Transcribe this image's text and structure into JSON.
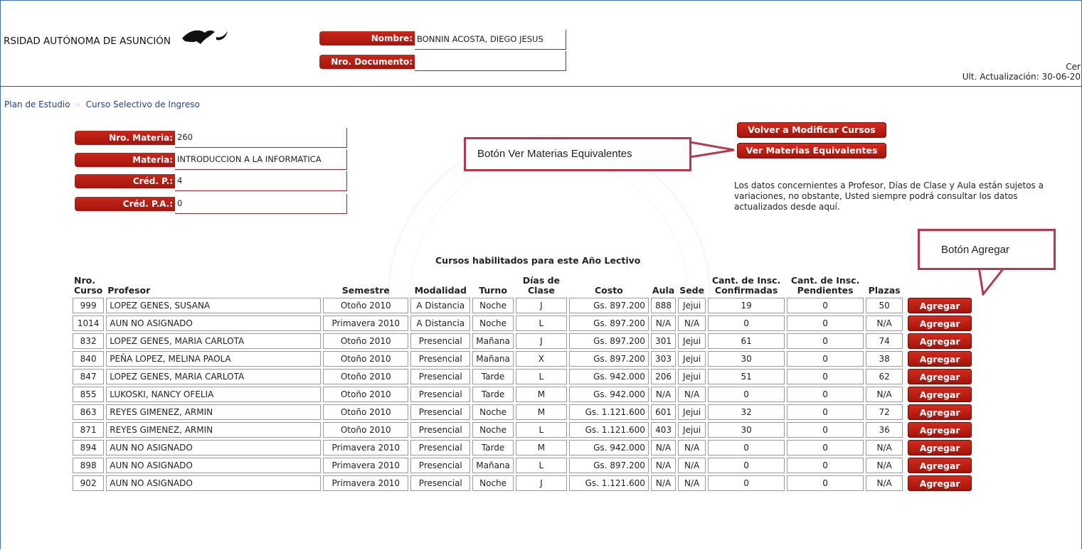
{
  "header": {
    "university": "RSIDAD AUTÓNOMA DE ASUNCIÓN",
    "nombre_label": "Nombre:",
    "nombre_value": "BONNIN ACOSTA, DIEGO JESUS",
    "documento_label": "Nro. Documento:",
    "documento_value": "",
    "top_right_1": "Cer",
    "top_right_2": "Ult. Actualización: 30-06-20"
  },
  "breadcrumb": {
    "item1": "Plan de Estudio",
    "separator": "⁘",
    "item2": "Curso Selectivo de Ingreso"
  },
  "materia": {
    "nro_label": "Nro. Materia:",
    "nro_value": "260",
    "materia_label": "Materia:",
    "materia_value": "INTRODUCCION A LA INFORMATICA",
    "credp_label": "Créd. P.:",
    "credp_value": "4",
    "credpa_label": "Créd. P.A.:",
    "credpa_value": "0"
  },
  "buttons": {
    "volver": "Volver a Modificar Cursos",
    "equivalentes": "Ver Materias Equivalentes"
  },
  "note": "Los datos concernientes a Profesor, Días de Clase y Aula están sujetos a variaciones, no obstante, Usted siempre podrá consultar los datos actualizados desde aquí.",
  "callouts": {
    "equivalentes": "Botón Ver Materias Equivalentes",
    "agregar": "Botón Agregar"
  },
  "table": {
    "caption": "Cursos habilitados para este Año Lectivo",
    "headers": {
      "nro_1": "Nro.",
      "nro_2": "Curso",
      "profesor": "Profesor",
      "semestre": "Semestre",
      "modalidad": "Modalidad",
      "turno": "Turno",
      "dias_1": "Días de",
      "dias_2": "Clase",
      "costo": "Costo",
      "aula": "Aula",
      "sede": "Sede",
      "conf_1": "Cant. de Insc.",
      "conf_2": "Confirmadas",
      "pend_1": "Cant. de Insc.",
      "pend_2": "Pendientes",
      "plazas": "Plazas"
    },
    "action_label": "Agregar",
    "rows": [
      {
        "nro": "999",
        "profesor": "LOPEZ GENES, SUSANA",
        "semestre": "Otoño 2010",
        "modalidad": "A Distancia",
        "turno": "Noche",
        "dias": "J",
        "costo": "Gs. 897.200",
        "aula": "888",
        "sede": "Jejui",
        "confirmadas": "19",
        "pendientes": "0",
        "plazas": "50"
      },
      {
        "nro": "1014",
        "profesor": "AUN NO ASIGNADO",
        "semestre": "Primavera 2010",
        "modalidad": "A Distancia",
        "turno": "Noche",
        "dias": "L",
        "costo": "Gs. 897.200",
        "aula": "N/A",
        "sede": "N/A",
        "confirmadas": "0",
        "pendientes": "0",
        "plazas": "N/A"
      },
      {
        "nro": "832",
        "profesor": "LOPEZ GENES, MARIA CARLOTA",
        "semestre": "Otoño 2010",
        "modalidad": "Presencial",
        "turno": "Mañana",
        "dias": "J",
        "costo": "Gs. 897.200",
        "aula": "301",
        "sede": "Jejui",
        "confirmadas": "61",
        "pendientes": "0",
        "plazas": "74"
      },
      {
        "nro": "840",
        "profesor": "PEÑA LOPEZ, MELINA PAOLA",
        "semestre": "Otoño 2010",
        "modalidad": "Presencial",
        "turno": "Mañana",
        "dias": "X",
        "costo": "Gs. 897.200",
        "aula": "303",
        "sede": "Jejui",
        "confirmadas": "30",
        "pendientes": "0",
        "plazas": "38"
      },
      {
        "nro": "847",
        "profesor": "LOPEZ GENES, MARIA CARLOTA",
        "semestre": "Otoño 2010",
        "modalidad": "Presencial",
        "turno": "Tarde",
        "dias": "L",
        "costo": "Gs. 942.000",
        "aula": "206",
        "sede": "Jejui",
        "confirmadas": "51",
        "pendientes": "0",
        "plazas": "62"
      },
      {
        "nro": "855",
        "profesor": "LUKOSKI, NANCY OFELIA",
        "semestre": "Otoño 2010",
        "modalidad": "Presencial",
        "turno": "Tarde",
        "dias": "M",
        "costo": "Gs. 942.000",
        "aula": "N/A",
        "sede": "N/A",
        "confirmadas": "0",
        "pendientes": "0",
        "plazas": "N/A"
      },
      {
        "nro": "863",
        "profesor": "REYES GIMENEZ, ARMIN",
        "semestre": "Otoño 2010",
        "modalidad": "Presencial",
        "turno": "Noche",
        "dias": "M",
        "costo": "Gs. 1.121.600",
        "aula": "601",
        "sede": "Jejui",
        "confirmadas": "32",
        "pendientes": "0",
        "plazas": "72"
      },
      {
        "nro": "871",
        "profesor": "REYES GIMENEZ, ARMIN",
        "semestre": "Otoño 2010",
        "modalidad": "Presencial",
        "turno": "Noche",
        "dias": "L",
        "costo": "Gs. 1.121.600",
        "aula": "403",
        "sede": "Jejui",
        "confirmadas": "30",
        "pendientes": "0",
        "plazas": "36"
      },
      {
        "nro": "894",
        "profesor": "AUN NO ASIGNADO",
        "semestre": "Primavera 2010",
        "modalidad": "Presencial",
        "turno": "Tarde",
        "dias": "M",
        "costo": "Gs. 942.000",
        "aula": "N/A",
        "sede": "N/A",
        "confirmadas": "0",
        "pendientes": "0",
        "plazas": "N/A"
      },
      {
        "nro": "898",
        "profesor": "AUN NO ASIGNADO",
        "semestre": "Primavera 2010",
        "modalidad": "Presencial",
        "turno": "Mañana",
        "dias": "L",
        "costo": "Gs. 897.200",
        "aula": "N/A",
        "sede": "N/A",
        "confirmadas": "0",
        "pendientes": "0",
        "plazas": "N/A"
      },
      {
        "nro": "902",
        "profesor": "AUN NO ASIGNADO",
        "semestre": "Primavera 2010",
        "modalidad": "Presencial",
        "turno": "Noche",
        "dias": "J",
        "costo": "Gs. 1.121.600",
        "aula": "N/A",
        "sede": "N/A",
        "confirmadas": "0",
        "pendientes": "0",
        "plazas": "N/A"
      }
    ]
  }
}
